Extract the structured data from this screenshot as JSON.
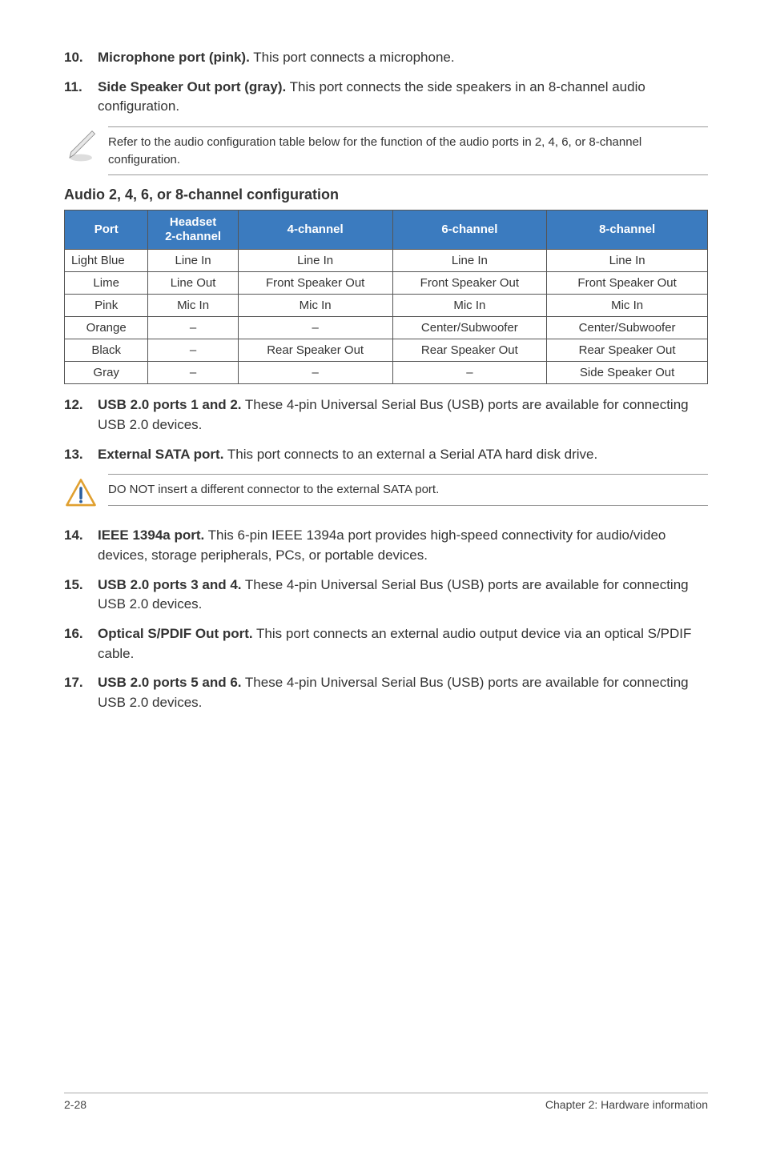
{
  "items": {
    "i10": {
      "num": "10.",
      "title": "Microphone port (pink).",
      "desc": " This port connects a microphone."
    },
    "i11": {
      "num": "11.",
      "title": "Side Speaker Out port (gray).",
      "desc": " This port connects the side speakers in an 8-channel audio configuration."
    },
    "i12": {
      "num": "12.",
      "title": "USB 2.0 ports 1 and 2.",
      "desc": " These 4-pin Universal Serial Bus (USB) ports are available for connecting USB 2.0 devices."
    },
    "i13": {
      "num": "13.",
      "title": "External SATA port.",
      "desc": " This port connects to an external a Serial ATA hard disk drive."
    },
    "i14": {
      "num": "14.",
      "title": "IEEE 1394a port.",
      "desc": " This 6-pin IEEE 1394a port provides high-speed connectivity for audio/video devices, storage peripherals, PCs, or portable devices."
    },
    "i15": {
      "num": "15.",
      "title": "USB 2.0 ports 3 and 4.",
      "desc": " These 4-pin Universal Serial Bus (USB) ports are available for connecting USB 2.0 devices."
    },
    "i16": {
      "num": "16.",
      "title": "Optical S/PDIF Out port.",
      "desc": " This port connects an external audio output device via an optical S/PDIF cable."
    },
    "i17": {
      "num": "17.",
      "title": "USB 2.0 ports 5 and 6.",
      "desc": " These 4-pin Universal Serial Bus (USB) ports are available for connecting USB 2.0 devices."
    }
  },
  "note1": "Refer to the audio configuration table below for the function of the audio ports in 2, 4, 6, or 8-channel configuration.",
  "tableHeading": "Audio 2, 4, 6, or 8-channel configuration",
  "chart_data": {
    "type": "table",
    "columns": [
      "Port",
      "Headset 2-channel",
      "4-channel",
      "6-channel",
      "8-channel"
    ],
    "rows": [
      [
        "Light Blue",
        "Line In",
        "Line In",
        "Line In",
        "Line In"
      ],
      [
        "Lime",
        "Line Out",
        "Front Speaker Out",
        "Front Speaker Out",
        "Front Speaker Out"
      ],
      [
        "Pink",
        "Mic In",
        "Mic In",
        "Mic In",
        "Mic In"
      ],
      [
        "Orange",
        "–",
        "–",
        "Center/Subwoofer",
        "Center/Subwoofer"
      ],
      [
        "Black",
        "–",
        "Rear Speaker Out",
        "Rear Speaker Out",
        "Rear Speaker Out"
      ],
      [
        "Gray",
        "–",
        "–",
        "–",
        "Side Speaker Out"
      ]
    ]
  },
  "note2": "DO NOT insert a different connector to the external SATA port.",
  "footer": {
    "left": "2-28",
    "right": "Chapter 2: Hardware information"
  }
}
